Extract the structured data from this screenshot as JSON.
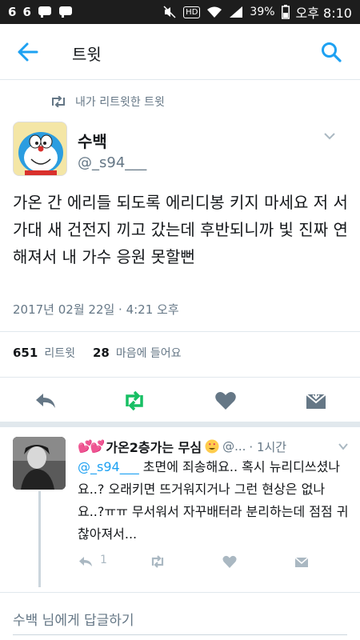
{
  "status_bar": {
    "left_icons": [
      "6",
      "6",
      "talk-icon",
      "talk-icon"
    ],
    "hd": "HD",
    "battery": "39%",
    "time": "오후 8:10"
  },
  "header": {
    "title": "트윗"
  },
  "tweet": {
    "retweet_context": "내가 리트윗한 트윗",
    "author_name": "수백",
    "author_handle": "@_s94___",
    "text": "가온 간 에리들 되도록 에리디봉 키지 마세요 저 서가대 새 건전지 끼고 갔는데 후반되니까 빛 진짜 연해져서 내 가수 응원 못할뻔",
    "timestamp": "2017년 02월 22일 · 4:21 오후",
    "retweets_count": "651",
    "retweets_label": "리트윗",
    "likes_count": "28",
    "likes_label": "마음에 들어요"
  },
  "reply": {
    "author_name": "가온2층가는 무심",
    "author_handle": "@...",
    "time": "· 1시간",
    "mention": "@_s94___",
    "text": " 초면에 죄송해요.. 혹시 뉴리디쓰셨나요..? 오래키면 뜨거워지거나 그런 현상은 없나요..?ㅠㅠ 무서워서 자꾸배터라 분리하는데 점점 귀찮아져서...",
    "reply_count": "1"
  },
  "composer": {
    "placeholder": "수백 님에게 답글하기"
  },
  "colors": {
    "accent": "#1da1f2",
    "retweet_green": "#17bf63",
    "muted": "#657786",
    "icon_gray": "#657786"
  }
}
